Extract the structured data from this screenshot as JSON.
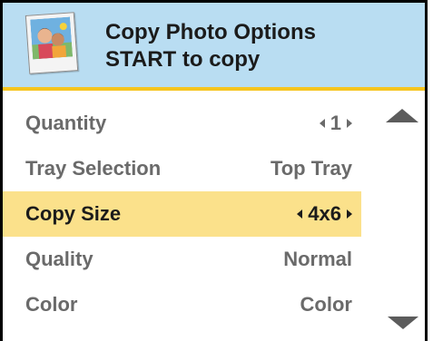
{
  "header": {
    "title": "Copy Photo Options",
    "subtitle": "START to copy",
    "icon": "photo-icon"
  },
  "menu": {
    "items": [
      {
        "label": "Quantity",
        "value": "1",
        "arrows": true,
        "selected": false
      },
      {
        "label": "Tray Selection",
        "value": "Top Tray",
        "arrows": false,
        "selected": false
      },
      {
        "label": "Copy Size",
        "value": "4x6",
        "arrows": true,
        "selected": true
      },
      {
        "label": "Quality",
        "value": "Normal",
        "arrows": false,
        "selected": false
      },
      {
        "label": "Color",
        "value": "Color",
        "arrows": false,
        "selected": false
      }
    ]
  },
  "colors": {
    "header_bg": "#b9ddf2",
    "header_border": "#f6c51e",
    "selected_bg": "#fbe18b",
    "text_dim": "#6a6a6a",
    "text_dark": "#1b1b1b"
  },
  "scroll": {
    "up_icon": "triangle-up-icon",
    "down_icon": "triangle-down-icon"
  }
}
